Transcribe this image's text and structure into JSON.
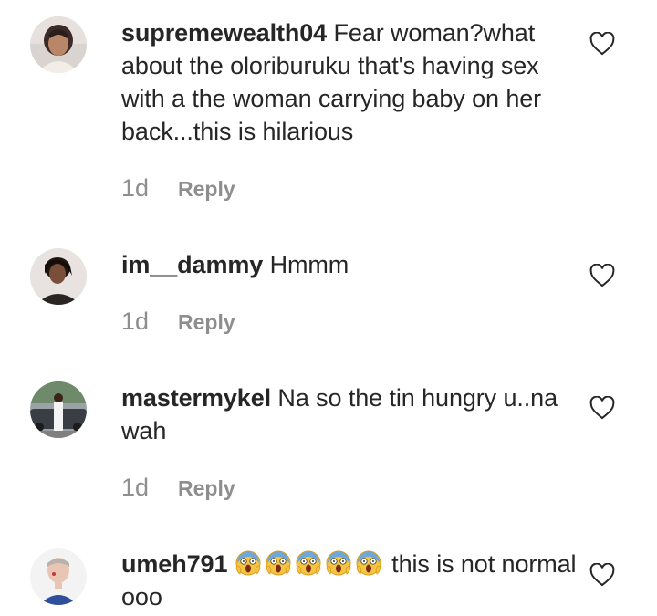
{
  "comments": [
    {
      "username": "supremewealth04",
      "text": "Fear woman?what about the oloriburuku that's having sex with a the woman carrying baby on her back...this is hilarious",
      "time": "1d",
      "reply_label": "Reply",
      "avatar_icon": "avatar-woman-icon",
      "like_icon": "heart-outline-icon"
    },
    {
      "username": "im__dammy",
      "text": "Hmmm",
      "time": "1d",
      "reply_label": "Reply",
      "avatar_icon": "avatar-woman-icon",
      "like_icon": "heart-outline-icon"
    },
    {
      "username": "mastermykel",
      "text": "Na so the tin hungry u..na wah",
      "time": "1d",
      "reply_label": "Reply",
      "avatar_icon": "avatar-man-car-icon",
      "like_icon": "heart-outline-icon"
    },
    {
      "username": "umeh791",
      "emojis": [
        "😱",
        "😱",
        "😱",
        "😱",
        "😱"
      ],
      "text": "this is not normal ooo",
      "avatar_icon": "avatar-man-icon",
      "like_icon": "heart-outline-icon"
    }
  ],
  "colors": {
    "text": "#262626",
    "secondary": "#8e8e8e",
    "background": "#ffffff"
  }
}
